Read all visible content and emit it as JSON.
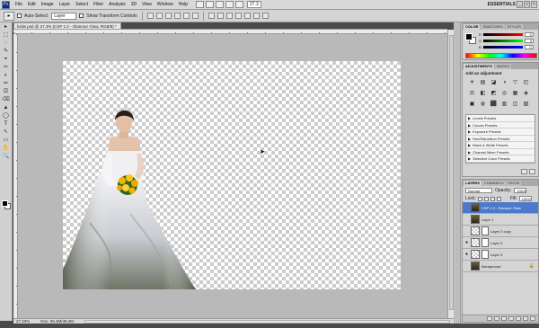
{
  "app": {
    "logo": "Ps"
  },
  "menu": [
    "File",
    "Edit",
    "Image",
    "Layer",
    "Select",
    "Filter",
    "Analysis",
    "3D",
    "View",
    "Window",
    "Help"
  ],
  "menubar": {
    "zoom": "27.3",
    "workspace": "ESSENTIALS",
    "window_buttons": [
      "_",
      "□",
      "×"
    ]
  },
  "options": {
    "auto_select_label": "Auto-Select:",
    "auto_select_value": "Layer",
    "show_transform_label": "Show Transform Controls"
  },
  "document": {
    "tab_title": "bride.psd @ 27.3% (CSP 1.0 - Glamour Glow, RGB/8) *",
    "status_zoom": "27.33%",
    "status_doc": "Doc: 26.4M/48.2M"
  },
  "tools": [
    "▸",
    "⬚",
    "◌",
    "✎",
    "⌖",
    "✂",
    "◐",
    "✏",
    "⎚",
    "⌫",
    "▲",
    "◯",
    "T",
    "↖",
    "▭",
    "✋",
    "🔍"
  ],
  "color_panel": {
    "tabs": [
      "COLOR",
      "SWATCHES",
      "STYLES"
    ],
    "channels": [
      {
        "label": "R",
        "value": "0",
        "color": "#e04040"
      },
      {
        "label": "G",
        "value": "0",
        "color": "#40b040"
      },
      {
        "label": "B",
        "value": "0",
        "color": "#4060e0"
      }
    ]
  },
  "adjustments_panel": {
    "tabs": [
      "ADJUSTMENTS",
      "MASKS"
    ],
    "title": "Add an adjustment",
    "icons": [
      "☀",
      "▤",
      "◪",
      "◑",
      "▽",
      "◰",
      "⚖",
      "◧",
      "◩",
      "◎",
      "▦",
      "◈",
      "▣",
      "◍",
      "⬛",
      "▥",
      "◫",
      "▨"
    ],
    "presets": [
      "Levels Presets",
      "Curves Presets",
      "Exposure Presets",
      "Hue/Saturation Presets",
      "Black & White Presets",
      "Channel Mixer Presets",
      "Selective Color Presets"
    ]
  },
  "layers_panel": {
    "tabs": [
      "LAYERS",
      "CHANNELS",
      "PATHS"
    ],
    "blend_mode": "Normal",
    "opacity_label": "Opacity:",
    "opacity_value": "100%",
    "lock_label": "Lock:",
    "fill_label": "Fill:",
    "fill_value": "100%",
    "layers": [
      {
        "name": "CSP 1.0 - Glamour Glow",
        "visible": false,
        "selected": true,
        "thumb": "photo",
        "mask": false
      },
      {
        "name": "Layer 1",
        "visible": false,
        "selected": false,
        "thumb": "photo",
        "mask": false
      },
      {
        "name": "Layer 2 copy",
        "visible": false,
        "selected": false,
        "thumb": "check",
        "mask": true
      },
      {
        "name": "Layer 2",
        "visible": true,
        "selected": false,
        "thumb": "check",
        "mask": true
      },
      {
        "name": "Layer 3",
        "visible": true,
        "selected": false,
        "thumb": "check",
        "mask": true
      },
      {
        "name": "Background",
        "visible": false,
        "selected": false,
        "thumb": "photo",
        "mask": false,
        "italic": true
      }
    ]
  }
}
